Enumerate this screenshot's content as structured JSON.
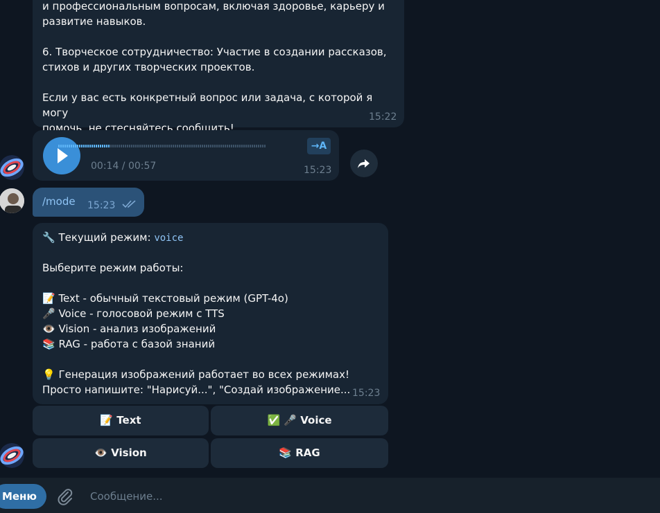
{
  "messages": {
    "top_text": {
      "p1": "и профессиональным вопросам, включая здоровье, карьеру и\nразвитие навыков.",
      "p2": "6. Творческое сотрудничество: Участие в создании рассказов,\nстихов и других творческих проектов.",
      "p3": "Если у вас есть конкретный вопрос или задача, с которой я могу\nпомочь, не стесняйтесь сообщить!",
      "time": "15:22"
    },
    "voice": {
      "transcribe_label": "→A",
      "duration": "00:14 / 00:57",
      "progress": 0.25,
      "time": "15:23"
    },
    "user_command": {
      "text": "/mode",
      "time": "15:23"
    },
    "mode_message": {
      "current_label": "🔧 Текущий режим: ",
      "current_value": "voice",
      "choose": "Выберите режим работы:",
      "opt_text": "📝 Text - обычный текстовый режим (GPT-4o)",
      "opt_voice": "🎤 Voice - голосовой режим с TTS",
      "opt_vision": "👁️ Vision - анализ изображений",
      "opt_rag": "📚 RAG - работа с базой знаний",
      "tip": "💡 Генерация изображений работает во всех режимах!",
      "tip2": "Просто напишите: \"Нарисуй...\", \"Создай изображение...",
      "time": "15:23"
    }
  },
  "keyboard": {
    "text": "📝 Text",
    "voice": "✅ 🎤 Voice",
    "vision": "👁️ Vision",
    "rag": "📚 RAG"
  },
  "composer": {
    "menu_label": "Меню",
    "placeholder": "Сообщение..."
  },
  "colors": {
    "background": "#0e1621",
    "incoming_bubble": "#182533",
    "outgoing_bubble": "#2b5278",
    "accent": "#3a8fd8"
  }
}
